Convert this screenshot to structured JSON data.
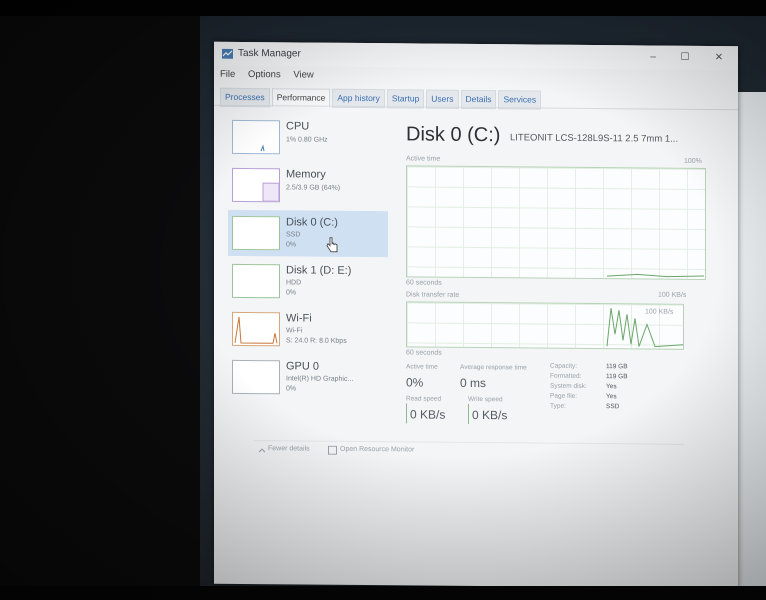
{
  "window": {
    "title": "Task Manager",
    "controls": [
      "–",
      "☐",
      "✕"
    ]
  },
  "menu": [
    "File",
    "Options",
    "View"
  ],
  "tabs": [
    "Processes",
    "Performance",
    "App history",
    "Startup",
    "Users",
    "Details",
    "Services"
  ],
  "sidebar": [
    {
      "title": "CPU",
      "line1": "1% 0.80 GHz",
      "line2": ""
    },
    {
      "title": "Memory",
      "line1": "2.5/3.9 GB (64%)",
      "line2": ""
    },
    {
      "title": "Disk 0 (C:)",
      "line1": "SSD",
      "line2": "0%"
    },
    {
      "title": "Disk 1 (D: E:)",
      "line1": "HDD",
      "line2": "0%"
    },
    {
      "title": "Wi-Fi",
      "line1": "Wi-Fi",
      "line2": "S: 24.0 R: 8.0 Kbps"
    },
    {
      "title": "GPU 0",
      "line1": "Intel(R) HD Graphic...",
      "line2": "0%"
    }
  ],
  "detail": {
    "title": "Disk 0 (C:)",
    "model": "LITEONIT LCS-128L9S-11 2.5 7mm 1...",
    "graph1_label": "Active time",
    "graph1_max": "100%",
    "graph1_duration": "60 seconds",
    "graph2_label": "Disk transfer rate",
    "graph2_max": "100 KB/s",
    "graph2_inner": "100 KB/s",
    "graph2_duration": "60 seconds",
    "stats": {
      "active_time_label": "Active time",
      "active_time_value": "0%",
      "response_label": "Average response time",
      "response_value": "0 ms",
      "read_label": "Read speed",
      "read_value": "0 KB/s",
      "write_label": "Write speed",
      "write_value": "0 KB/s"
    },
    "properties": [
      {
        "k": "Capacity:",
        "v": "119 GB"
      },
      {
        "k": "Formatted:",
        "v": "119 GB"
      },
      {
        "k": "System disk:",
        "v": "Yes"
      },
      {
        "k": "Page file:",
        "v": "Yes"
      },
      {
        "k": "Type:",
        "v": "SSD"
      }
    ]
  },
  "footer": {
    "fewer": "Fewer details",
    "resmon": "Open Resource Monitor"
  },
  "colors": {
    "accent": "#3b6fb0",
    "graph_border": "#b8d2b8",
    "selected": "#cfe0f3"
  }
}
